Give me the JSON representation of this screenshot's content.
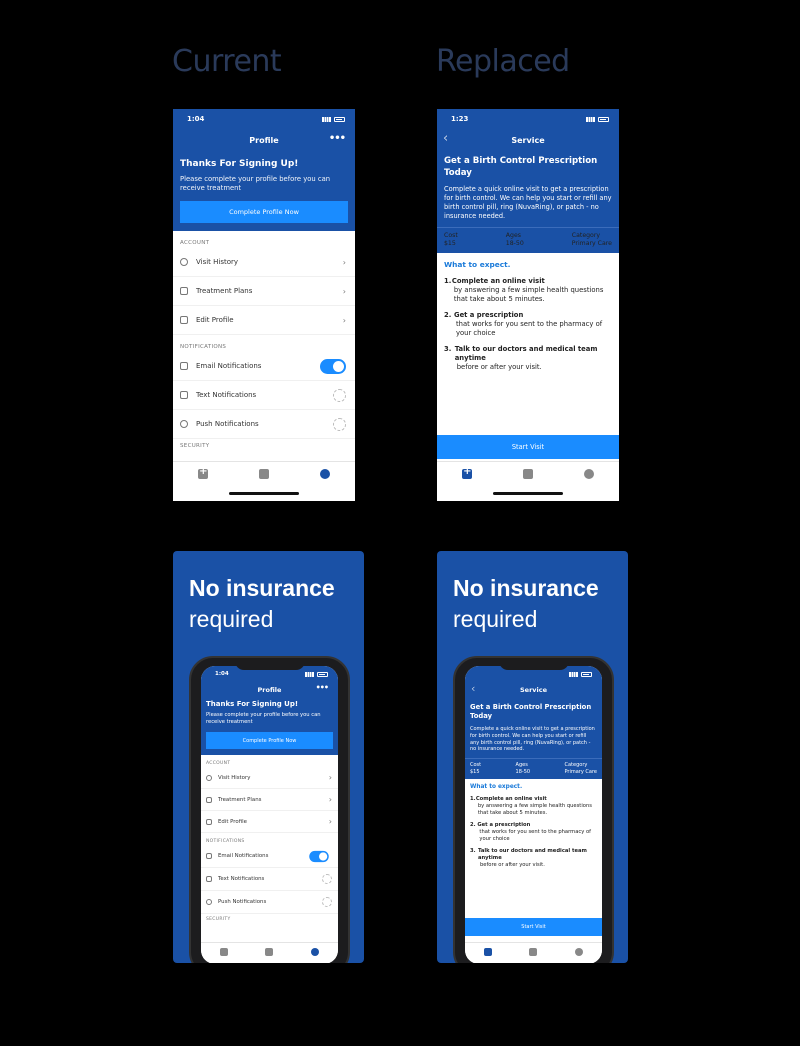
{
  "labels": {
    "current": "Current",
    "replaced": "Replaced"
  },
  "profile": {
    "time": "1:04",
    "nav_title": "Profile",
    "more": "•••",
    "heading": "Thanks For Signing Up!",
    "subtext": "Please complete your profile before you can receive treatment",
    "button": "Complete Profile Now",
    "account_header": "ACCOUNT",
    "rows": [
      "Visit History",
      "Treatment Plans",
      "Edit Profile"
    ],
    "notif_header": "NOTIFICATIONS",
    "notif_rows": [
      "Email Notifications",
      "Text Notifications",
      "Push Notifications"
    ],
    "security_header": "SECURITY"
  },
  "service": {
    "time": "1:23",
    "back": "‹",
    "nav_title": "Service",
    "heading": "Get a Birth Control Prescription Today",
    "subtext": "Complete a quick online visit to get a prescription for birth control. We can help you start or refill any birth control pill, ring (NuvaRing), or patch - no insurance needed.",
    "info": {
      "cost_label": "Cost",
      "cost_value": "$15",
      "ages_label": "Ages",
      "ages_value": "18-50",
      "cat_label": "Category",
      "cat_value": "Primary Care"
    },
    "expect": "What to expect.",
    "steps": [
      {
        "num": "1.",
        "title": "Complete an online visit",
        "desc": "by answering a few simple health questions that take about 5 minutes."
      },
      {
        "num": "2.",
        "title": "Get a prescription",
        "desc": "that works for you sent to the pharmacy of your choice"
      },
      {
        "num": "3.",
        "title": "Talk to our doctors and medical team anytime",
        "desc": "before or after your visit."
      }
    ],
    "button": "Start Visit"
  },
  "card": {
    "line1": "No insurance",
    "line2": "required"
  }
}
